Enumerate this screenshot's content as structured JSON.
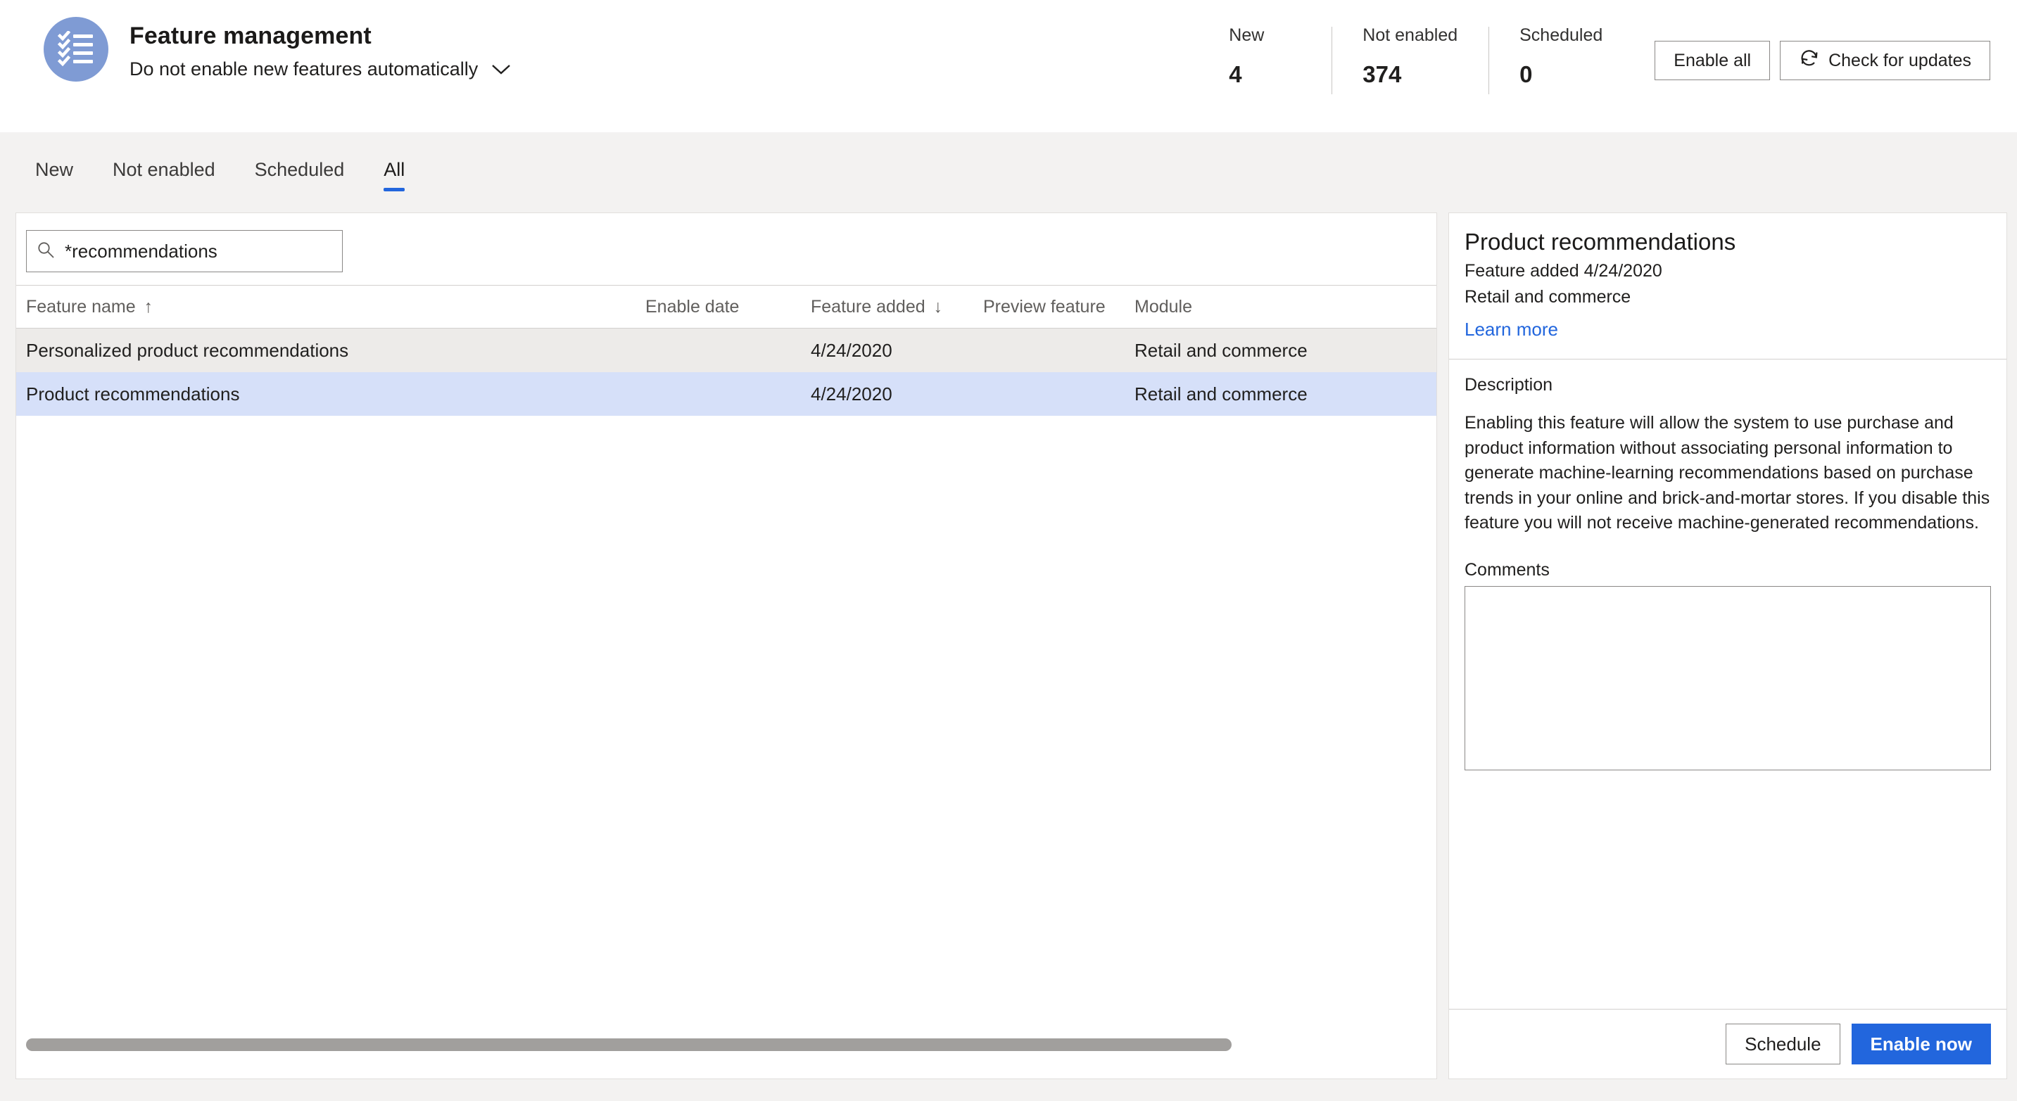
{
  "header": {
    "icon": "checklist-icon",
    "title": "Feature management",
    "subtitle": "Do not enable new features automatically",
    "chevron_icon": "chevron-down-icon",
    "stats": [
      {
        "label": "New",
        "value": "4"
      },
      {
        "label": "Not enabled",
        "value": "374"
      },
      {
        "label": "Scheduled",
        "value": "0"
      }
    ],
    "actions": {
      "enable_all": "Enable all",
      "check_updates": "Check for updates",
      "check_updates_icon": "refresh-icon"
    }
  },
  "tabs": [
    {
      "label": "New",
      "active": false
    },
    {
      "label": "Not enabled",
      "active": false
    },
    {
      "label": "Scheduled",
      "active": false
    },
    {
      "label": "All",
      "active": true
    }
  ],
  "search": {
    "value": "*recommendations",
    "placeholder": "",
    "icon": "search-icon"
  },
  "grid": {
    "columns": [
      {
        "label": "Feature name",
        "sort": "↑"
      },
      {
        "label": "Enable date",
        "sort": ""
      },
      {
        "label": "Feature added",
        "sort": "↓"
      },
      {
        "label": "Preview feature",
        "sort": ""
      },
      {
        "label": "Module",
        "sort": ""
      }
    ],
    "rows": [
      {
        "feature_name": "Personalized product recommendations",
        "enable_date": "",
        "feature_added": "4/24/2020",
        "preview_feature": "",
        "module": "Retail and commerce",
        "state": "hover"
      },
      {
        "feature_name": "Product recommendations",
        "enable_date": "",
        "feature_added": "4/24/2020",
        "preview_feature": "",
        "module": "Retail and commerce",
        "state": "selected"
      }
    ]
  },
  "details": {
    "title": "Product recommendations",
    "added": "Feature added 4/24/2020",
    "module": "Retail and commerce",
    "learn_more": "Learn more",
    "description_label": "Description",
    "description": "Enabling this feature will allow the system to use purchase and product information without associating personal information to generate machine-learning recommendations based on purchase trends in your online and brick-and-mortar stores. If you disable this feature you will not receive machine-generated recommendations.",
    "comments_label": "Comments",
    "comments_value": "",
    "schedule_label": "Schedule",
    "enable_now_label": "Enable now"
  },
  "colors": {
    "accent": "#2266dd",
    "selected_row": "#d6e0f9",
    "hover_row": "#edebe9",
    "icon_circle": "#7f9bd4",
    "chrome": "#f3f2f1"
  }
}
